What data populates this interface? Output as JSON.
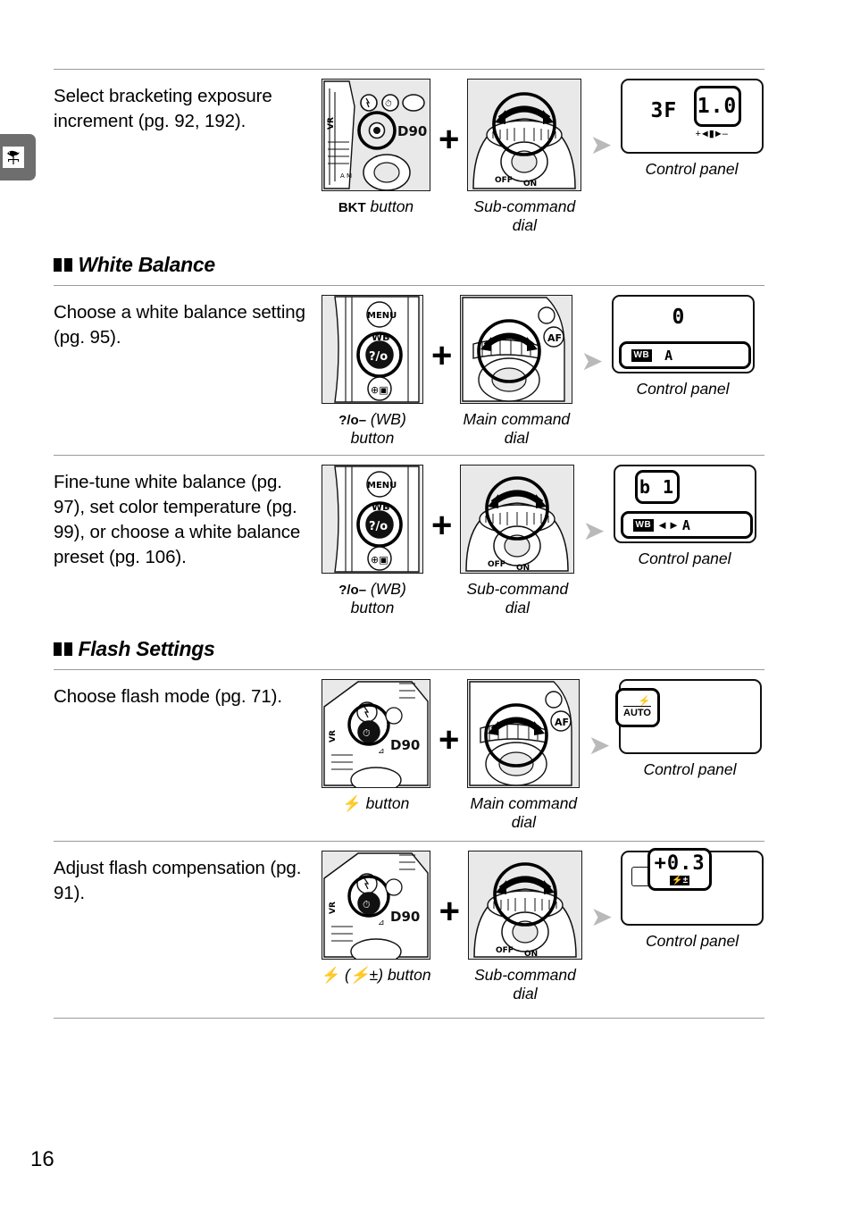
{
  "page": {
    "number": "16",
    "margin_tab_icon": "weathervane-icon"
  },
  "sections": [
    {
      "id": "bracketing",
      "heading": null,
      "rows": [
        {
          "description": "Select bracketing exposure increment (pg. 92, 192).",
          "button_caption_prefix": "BKT",
          "button_caption": " button",
          "dial_caption": "Sub-command\ndial",
          "panel_caption": "Control panel",
          "lcd": {
            "primary": "3F",
            "value": "1.0",
            "sub_marks": "+◄▮►–",
            "highlight": "value"
          }
        }
      ]
    },
    {
      "id": "white-balance",
      "heading": "White Balance",
      "rows": [
        {
          "description": "Choose a white balance setting (pg. 95).",
          "button_caption_prefix": "?/o–",
          "button_caption": " (WB)\nbutton",
          "dial_caption": "Main command\ndial",
          "panel_caption": "Control panel",
          "lcd": {
            "primary": "0",
            "wb_chip": "WB",
            "wb_value": "A",
            "highlight": "wb-row"
          }
        },
        {
          "description": "Fine-tune white balance (pg. 97), set color temperature (pg. 99), or choose a white balance preset (pg. 106).",
          "button_caption_prefix": "?/o–",
          "button_caption": " (WB)\nbutton",
          "dial_caption": "Sub-command\ndial",
          "panel_caption": "Control panel",
          "lcd": {
            "primary": "b 1",
            "wb_chip": "WB",
            "wb_arrows": "◄►",
            "wb_value": "A",
            "highlight": "both"
          }
        }
      ]
    },
    {
      "id": "flash-settings",
      "heading": "Flash Settings",
      "rows": [
        {
          "description": "Choose flash mode (pg. 71).",
          "button_caption_prefix": "⚡",
          "button_caption": " button",
          "dial_caption": "Main command\ndial",
          "panel_caption": "Control panel",
          "lcd": {
            "flash_mode": "AUTO",
            "flash_icon": "flash-bolt-icon",
            "highlight": "flash-mode"
          }
        },
        {
          "description": "Adjust flash compensation (pg. 91).",
          "button_caption_prefix": "⚡",
          "button_caption": " (⚡±) button",
          "dial_caption": "Sub-command\ndial",
          "panel_caption": "Control panel",
          "lcd": {
            "value": "+0.3",
            "comp_icon": "flash-compensation-icon",
            "highlight": "value"
          }
        }
      ]
    }
  ]
}
